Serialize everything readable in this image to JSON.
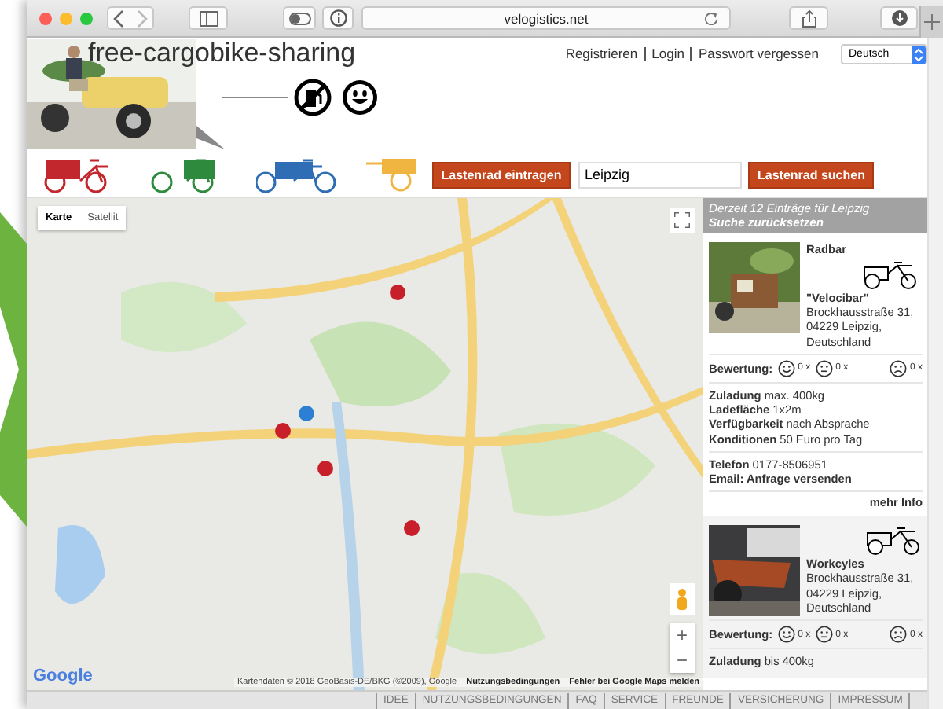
{
  "browser": {
    "url": "velogistics.net"
  },
  "header": {
    "title": "free-cargobike-sharing",
    "links": [
      "Registrieren",
      "Login",
      "Passwort vergessen"
    ],
    "language": "Deutsch"
  },
  "bike_types": [
    {
      "kind": "front-box",
      "color": "#c1272d"
    },
    {
      "kind": "rear-box",
      "color": "#2e8b3e"
    },
    {
      "kind": "long-box",
      "color": "#2f6db5"
    },
    {
      "kind": "trailer",
      "color": "#f0b441"
    }
  ],
  "search": {
    "add_button": "Lastenrad eintragen",
    "value": "Leipzig",
    "search_button": "Lastenrad suchen"
  },
  "map": {
    "map_types": [
      {
        "label": "Karte",
        "selected": true
      },
      {
        "label": "Satellit",
        "selected": false
      }
    ],
    "zoom_in": "+",
    "zoom_out": "−",
    "logo": "Google",
    "attribution": "Kartendaten © 2018 GeoBasis-DE/BKG (©2009), Google",
    "terms": "Nutzungsbedingungen",
    "report": "Fehler bei Google Maps melden"
  },
  "results": {
    "summary": "Derzeit 12 Einträge für Leipzig",
    "reset": "Suche zurücksetzen",
    "entries": [
      {
        "category": "Radbar",
        "name": "\"Velocibar\"",
        "address": "Brockhausstraße 31, 04229 Leipzig, Deutschland",
        "rating_label": "Bewertung:",
        "ratings": [
          {
            "kind": "happy",
            "count": "0 x"
          },
          {
            "kind": "neutral",
            "count": "0 x"
          },
          {
            "kind": "sad",
            "count": "0 x"
          }
        ],
        "details": [
          {
            "label": "Zuladung",
            "value": "max. 400kg"
          },
          {
            "label": "Ladefläche",
            "value": "1x2m"
          },
          {
            "label": "Verfügbarkeit",
            "value": "nach Absprache"
          },
          {
            "label": "Konditionen",
            "value": "50 Euro pro Tag"
          }
        ],
        "phone_label": "Telefon",
        "phone": "0177-8506951",
        "email": "Email: Anfrage versenden",
        "more": "mehr Info"
      },
      {
        "name": "Workcyles",
        "address": "Brockhausstraße 31, 04229 Leipzig, Deutschland",
        "rating_label": "Bewertung:",
        "ratings": [
          {
            "kind": "happy",
            "count": "0 x"
          },
          {
            "kind": "neutral",
            "count": "0 x"
          },
          {
            "kind": "sad",
            "count": "0 x"
          }
        ],
        "details": [
          {
            "label": "Zuladung",
            "value": "bis 400kg"
          }
        ]
      }
    ]
  },
  "footer": [
    "IDEE",
    "NUTZUNGSBEDINGUNGEN",
    "FAQ",
    "SERVICE",
    "FREUNDE",
    "VERSICHERUNG",
    "IMPRESSUM"
  ]
}
